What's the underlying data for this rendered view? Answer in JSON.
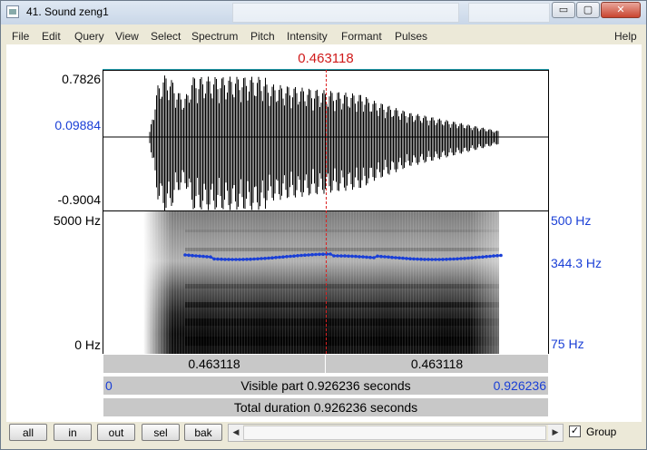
{
  "window": {
    "title": "41. Sound zeng1"
  },
  "title_buttons": {
    "minimize": "▭",
    "maximize": "▢",
    "close": "✕"
  },
  "menu": {
    "items": [
      "File",
      "Edit",
      "Query",
      "View",
      "Select",
      "Spectrum",
      "Pitch",
      "Intensity",
      "Formant",
      "Pulses"
    ],
    "help": "Help"
  },
  "cursor": {
    "time_label": "0.463118"
  },
  "waveform": {
    "ymax": "0.7826",
    "ymid": "0.09884",
    "ymin": "-0.9004"
  },
  "spectrogram": {
    "fmax": "5000 Hz",
    "fmin": "0 Hz"
  },
  "pitch": {
    "top": "500 Hz",
    "current": "344.3 Hz",
    "bottom": "75 Hz",
    "color": "#1a3fd6"
  },
  "bars": {
    "left_time": "0.463118",
    "right_time": "0.463118",
    "visible_start": "0",
    "visible_label": "Visible part 0.926236 seconds",
    "visible_end": "0.926236",
    "total_label": "Total duration 0.926236 seconds"
  },
  "buttons": {
    "all": "all",
    "in": "in",
    "out": "out",
    "sel": "sel",
    "bak": "bak"
  },
  "scrollbar": {
    "left": "◀",
    "right": "▶"
  },
  "group": {
    "label": "Group",
    "checked": "✓"
  },
  "colors": {
    "cursor": "#d01a1a",
    "label_blue": "#1a3fd6"
  }
}
